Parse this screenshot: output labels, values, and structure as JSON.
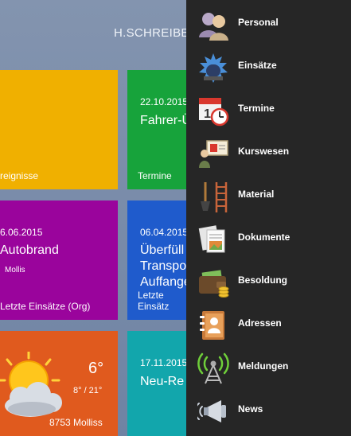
{
  "header": {
    "user_name": "H.SCHREIBE"
  },
  "tiles": {
    "yellow": {
      "label": "reignisse",
      "color": "#f0b000"
    },
    "green": {
      "date": "22.10.2015",
      "title": "Fahrer-Ü",
      "label": "Termine",
      "color": "#17a33b"
    },
    "purple": {
      "date": "6.06.2015",
      "title": "Autobrand",
      "sub": "Mollis",
      "label": "Letzte Einsätze (Org)",
      "color": "#9a049c"
    },
    "blue": {
      "date": "06.04.2015",
      "title_lines": [
        "Überfüll",
        "Transpo",
        "Auffange"
      ],
      "label": "Letzte Einsätz",
      "color": "#1f5bcc"
    },
    "weather": {
      "temp": "6°",
      "range": "8° / 21°",
      "location": "8753 Molliss",
      "color": "#e05a1e"
    },
    "teal": {
      "date": "17.11.2015",
      "title": "Neu-Re",
      "color": "#12a6ac"
    }
  },
  "menu": {
    "items": [
      {
        "label": "Personal",
        "icon": "people-icon"
      },
      {
        "label": "Einsätze",
        "icon": "siren-icon"
      },
      {
        "label": "Termine",
        "icon": "calendar-clock-icon"
      },
      {
        "label": "Kurswesen",
        "icon": "presentation-icon"
      },
      {
        "label": "Material",
        "icon": "tools-icon"
      },
      {
        "label": "Dokumente",
        "icon": "documents-icon"
      },
      {
        "label": "Besoldung",
        "icon": "wallet-icon"
      },
      {
        "label": "Adressen",
        "icon": "address-book-icon"
      },
      {
        "label": "Meldungen",
        "icon": "antenna-icon"
      },
      {
        "label": "News",
        "icon": "megaphone-icon"
      }
    ]
  }
}
